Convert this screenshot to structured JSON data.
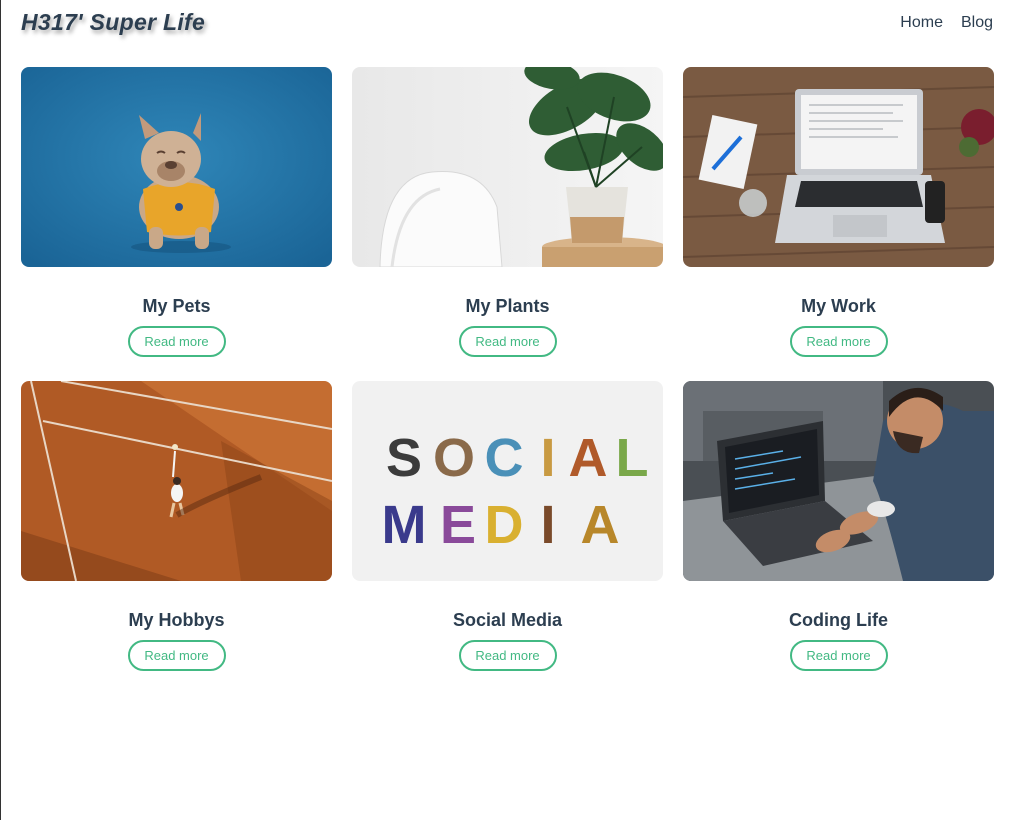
{
  "header": {
    "logo": "H317' Super Life",
    "nav": [
      "Home",
      "Blog"
    ]
  },
  "cards": [
    {
      "title": "My Pets",
      "button": "Read more",
      "image": "french-bulldog-photo"
    },
    {
      "title": "My Plants",
      "button": "Read more",
      "image": "monstera-plant-photo"
    },
    {
      "title": "My Work",
      "button": "Read more",
      "image": "laptop-desk-photo"
    },
    {
      "title": "My Hobbys",
      "button": "Read more",
      "image": "tennis-court-photo"
    },
    {
      "title": "Social Media",
      "button": "Read more",
      "image": "social-media-letters-photo"
    },
    {
      "title": "Coding Life",
      "button": "Read more",
      "image": "man-coding-laptop-photo"
    }
  ],
  "images": {
    "social_media_letters": [
      "SOCIAL",
      "MEDIA"
    ]
  },
  "colors": {
    "accent": "#42b983",
    "text": "#2c3e50"
  }
}
